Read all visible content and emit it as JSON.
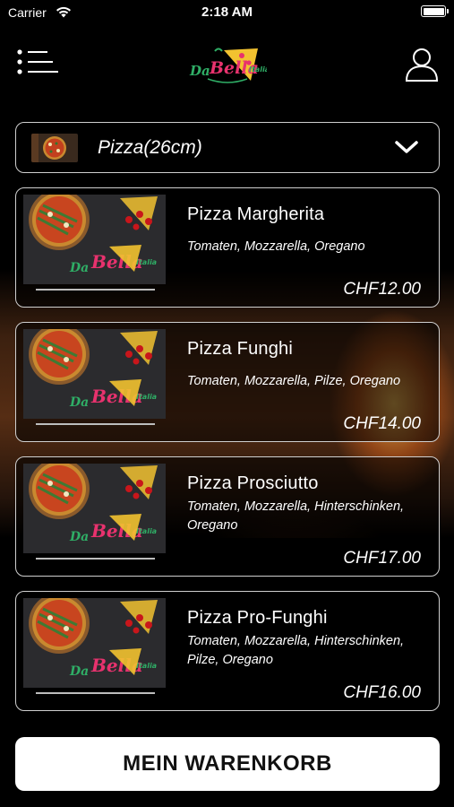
{
  "status_bar": {
    "carrier": "Carrier",
    "time": "2:18 AM"
  },
  "header": {
    "menu_icon": "menu-list-icon",
    "logo_text": [
      "Da",
      "Bella",
      "Italia"
    ],
    "user_icon": "user-icon"
  },
  "category": {
    "label": "Pizza(26cm)",
    "icon": "chevron-down-icon"
  },
  "products": [
    {
      "name": "Pizza Margherita",
      "description": "Tomaten, Mozzarella, Oregano",
      "price": "CHF12.00"
    },
    {
      "name": "Pizza Funghi",
      "description": "Tomaten, Mozzarella, Pilze, Oregano",
      "price": "CHF14.00"
    },
    {
      "name": "Pizza Prosciutto",
      "description": "Tomaten, Mozzarella, Hinterschinken, Oregano",
      "price": "CHF17.00"
    },
    {
      "name": "Pizza Pro-Funghi",
      "description": "Tomaten, Mozzarella, Hinterschinken, Pilze, Oregano",
      "price": "CHF16.00"
    }
  ],
  "cart_button": {
    "label": "MEIN WARENKORB"
  },
  "colors": {
    "background": "#000000",
    "border": "#cfcfcf",
    "button_bg": "#ffffff",
    "logo_pink": "#e8326e",
    "logo_green": "#2fae66",
    "logo_yellow": "#f2c230"
  }
}
